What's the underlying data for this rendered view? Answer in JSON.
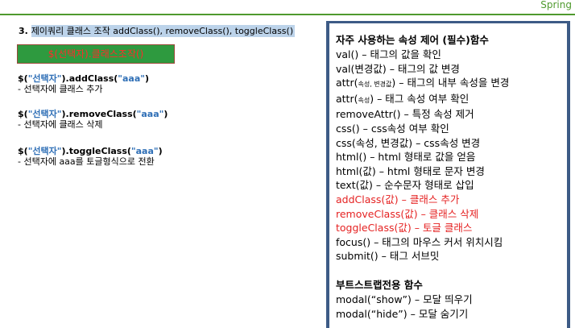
{
  "brand": "Spring",
  "heading": {
    "number": "3.",
    "highlight": "제이쿼리 클래스 조작 addClass(), removeClass(), toggleClass()"
  },
  "demo_button": "$(선택자).클래스조작()",
  "examples": [
    {
      "pre": "$(",
      "q1": "\"선택자\"",
      "mid": ").addClass(",
      "q2": "\"aaa\"",
      "post": ")",
      "desc": "- 선택자에 클래스 추가"
    },
    {
      "pre": "$(",
      "q1": "\"선택자\"",
      "mid": ").removeClass(",
      "q2": "\"aaa\"",
      "post": ")",
      "desc": "- 선택자에 클래스 삭제"
    },
    {
      "pre": "$(",
      "q1": "\"선택자\"",
      "mid": ").toggleClass(",
      "q2": "\"aaa\"",
      "post": ")",
      "desc": "- 선택자에 aaa를 토글형식으로 전환"
    }
  ],
  "panel": {
    "title": "자주 사용하는 속성 제어 (필수)함수",
    "items": [
      "val() – 태그의 값을 확인",
      "val(변경값) – 태그의 값 변경",
      {
        "pre": "attr(",
        "small": "속성, 변경값",
        "post": ") – 태그의 내부 속성을 변경"
      },
      {
        "pre": "attr(",
        "small": "속성",
        "post": ") – 태그 속성 여부 확인"
      },
      "removeAttr() – 특정 속성 제거",
      "css() – css속성 여부 확인",
      "css(속성, 변경값) – css속성 변경",
      "html() – html 형태로 값을 얻음",
      "html(값) – html 형태로 문자 변경",
      "text(값) – 순수문자 형태로 삽입"
    ],
    "red_items": [
      "addClass(값) – 클래스 추가",
      "removeClass(값) – 클래스 삭제",
      "toggleClass(값) – 토글 클래스"
    ],
    "items2": [
      "focus() – 태그의 마우스 커서 위치시킴",
      "submit() – 태그 서브밋"
    ],
    "bootstrap_title": "부트스트랩전용 함수",
    "bootstrap_items": [
      "modal(“show”) – 모달 띄우기",
      "modal(“hide”) – 모달 숨기기"
    ]
  },
  "colors": {
    "brand_green": "#4f9a2e",
    "panel_border": "#3d5b86",
    "red": "#e52222",
    "quote_blue": "#2f6fb6",
    "button_green": "#2e9a3f"
  }
}
